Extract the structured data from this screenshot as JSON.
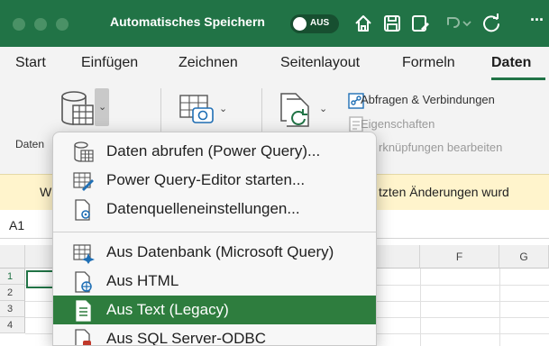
{
  "titlebar": {
    "autosave_label": "Automatisches Speichern",
    "autosave_state": "AUS",
    "more": "···"
  },
  "tabs": [
    "Start",
    "Einfügen",
    "Zeichnen",
    "Seitenlayout",
    "Formeln",
    "Daten"
  ],
  "active_tab": "Daten",
  "ribbon": {
    "daten_label": "Daten",
    "queries_label": "Abfragen & Verbindungen",
    "properties_label": "Eigenschaften",
    "links_label": "rknüpfungen bearbeiten"
  },
  "notification": {
    "left_text": "W",
    "right_text": "tzten Änderungen wurd"
  },
  "formula_bar": {
    "name_box": "A1"
  },
  "grid": {
    "columns": [
      "F",
      "G"
    ],
    "rows": [
      "1",
      "2",
      "3",
      "4"
    ]
  },
  "menu": {
    "items": [
      {
        "label": "Daten abrufen (Power Query)...",
        "icon": "get-data-icon"
      },
      {
        "label": "Power Query-Editor starten...",
        "icon": "query-editor-icon"
      },
      {
        "label": "Datenquelleneinstellungen...",
        "icon": "datasource-settings-icon"
      },
      {
        "label": "Aus Datenbank (Microsoft Query)",
        "icon": "database-query-icon"
      },
      {
        "label": "Aus HTML",
        "icon": "html-file-icon"
      },
      {
        "label": "Aus Text (Legacy)",
        "icon": "text-file-icon"
      },
      {
        "label": "Aus SQL Server-ODBC",
        "icon": "sql-odbc-icon"
      }
    ],
    "selected_index": 5
  },
  "colors": {
    "brand_green": "#217346",
    "menu_highlight": "#2e7d3e",
    "notification_bg": "#fff4cc"
  }
}
